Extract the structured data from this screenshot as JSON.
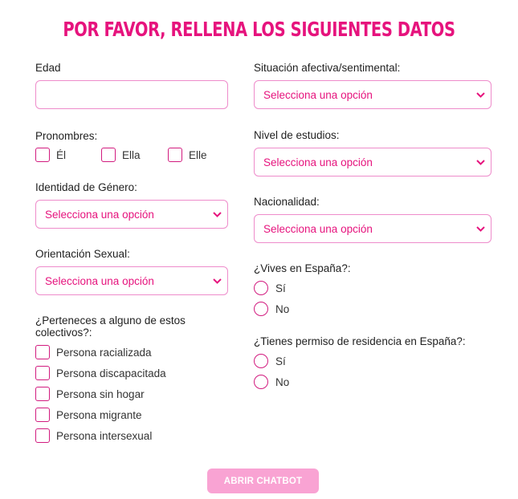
{
  "title": "POR FAVOR, RELLENA LOS SIGUIENTES DATOS",
  "select_placeholder": "Selecciona una opción",
  "left": {
    "edad_label": "Edad",
    "edad_value": "",
    "pronombres_label": "Pronombres:",
    "pronombres": [
      "Él",
      "Ella",
      "Elle"
    ],
    "identidad_label": "Identidad de Género:",
    "orientacion_label": "Orientación Sexual:",
    "colectivos_label_1": "¿Perteneces a alguno de estos",
    "colectivos_label_2": "colectivos?:",
    "colectivos": [
      "Persona racializada",
      "Persona discapacitada",
      "Persona sin hogar",
      "Persona migrante",
      "Persona intersexual"
    ]
  },
  "right": {
    "situacion_label": "Situación afectiva/sentimental:",
    "estudios_label": "Nivel de estudios:",
    "nacionalidad_label": "Nacionalidad:",
    "vives_label": "¿Vives en España?:",
    "vives_options": [
      "Sí",
      "No"
    ],
    "permiso_label": "¿Tienes permiso de residencia en España?:",
    "permiso_options": [
      "Sí",
      "No"
    ]
  },
  "button_label": "ABRIR CHATBOT",
  "colors": {
    "accent": "#e6137d",
    "border": "#ee8ccb",
    "button": "#f9a3d3"
  }
}
